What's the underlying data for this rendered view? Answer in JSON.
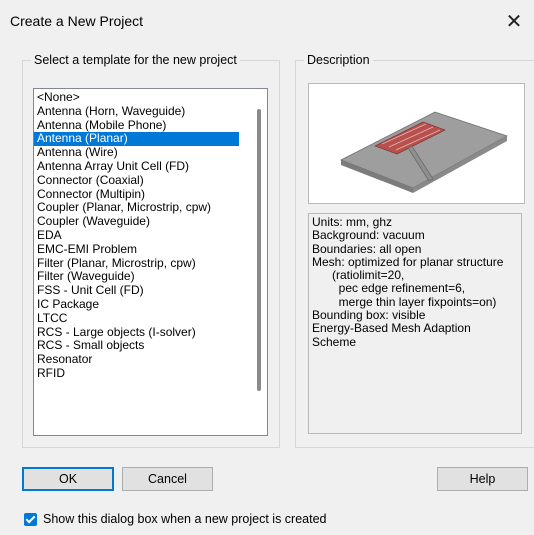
{
  "window": {
    "title": "Create a New Project"
  },
  "templates": {
    "legend": "Select a template for the new project",
    "selected_index": 3,
    "items": [
      "<None>",
      "Antenna (Horn, Waveguide)",
      "Antenna (Mobile Phone)",
      "Antenna (Planar)",
      "Antenna (Wire)",
      "Antenna Array Unit Cell (FD)",
      "Connector (Coaxial)",
      "Connector (Multipin)",
      "Coupler (Planar, Microstrip, cpw)",
      "Coupler (Waveguide)",
      "EDA",
      "EMC-EMI Problem",
      "Filter (Planar, Microstrip, cpw)",
      "Filter (Waveguide)",
      "FSS - Unit Cell (FD)",
      "IC Package",
      "LTCC",
      "RCS - Large objects (I-solver)",
      "RCS - Small objects",
      "Resonator",
      "RFID"
    ]
  },
  "description": {
    "legend": "Description",
    "lines": [
      "Units: mm, ghz",
      "Background: vacuum",
      "Boundaries: all open",
      "Mesh: optimized for planar structure",
      "      (ratiolimit=20,",
      "        pec edge refinement=6,",
      "        merge thin layer fixpoints=on)",
      "Bounding box: visible",
      "Energy-Based Mesh Adaption",
      "Scheme"
    ]
  },
  "buttons": {
    "ok": "OK",
    "cancel": "Cancel",
    "help": "Help"
  },
  "checkbox": {
    "label": "Show this dialog box when a new project is created",
    "checked": true
  },
  "icons": {
    "close": "close-icon",
    "checkbox": "checkbox-icon"
  },
  "colors": {
    "selection": "#0078d7",
    "background": "#f0f0f0"
  }
}
